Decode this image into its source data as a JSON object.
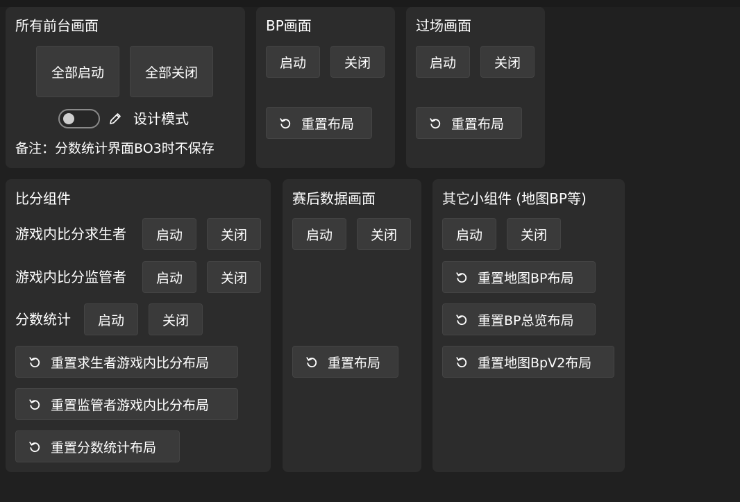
{
  "colors": {
    "background": "#202020",
    "panel": "#2c2c2c",
    "button": "#3a3a3a",
    "button_border": "#444444",
    "text": "#ffffff"
  },
  "icons": {
    "reset": "rotate-ccw-icon",
    "design_mode": "pencil-icon"
  },
  "all_front": {
    "title": "所有前台画面",
    "start_all": "全部启动",
    "close_all": "全部关闭",
    "design_mode_label": "设计模式",
    "design_mode_on": false,
    "note": "备注：分数统计界面BO3时不保存"
  },
  "bp": {
    "title": "BP画面",
    "start": "启动",
    "close": "关闭",
    "reset": "重置布局"
  },
  "transition": {
    "title": "过场画面",
    "start": "启动",
    "close": "关闭",
    "reset": "重置布局"
  },
  "score": {
    "title": "比分组件",
    "rows": [
      {
        "label": "游戏内比分求生者",
        "start": "启动",
        "close": "关闭"
      },
      {
        "label": "游戏内比分监管者",
        "start": "启动",
        "close": "关闭"
      },
      {
        "label": "分数统计",
        "start": "启动",
        "close": "关闭"
      }
    ],
    "resets": [
      "重置求生者游戏内比分布局",
      "重置监管者游戏内比分布局",
      "重置分数统计布局"
    ]
  },
  "postgame": {
    "title": "赛后数据画面",
    "start": "启动",
    "close": "关闭",
    "reset": "重置布局"
  },
  "widgets": {
    "title": "其它小组件 (地图BP等)",
    "start": "启动",
    "close": "关闭",
    "resets": [
      "重置地图BP布局",
      "重置BP总览布局",
      "重置地图BpV2布局"
    ]
  }
}
